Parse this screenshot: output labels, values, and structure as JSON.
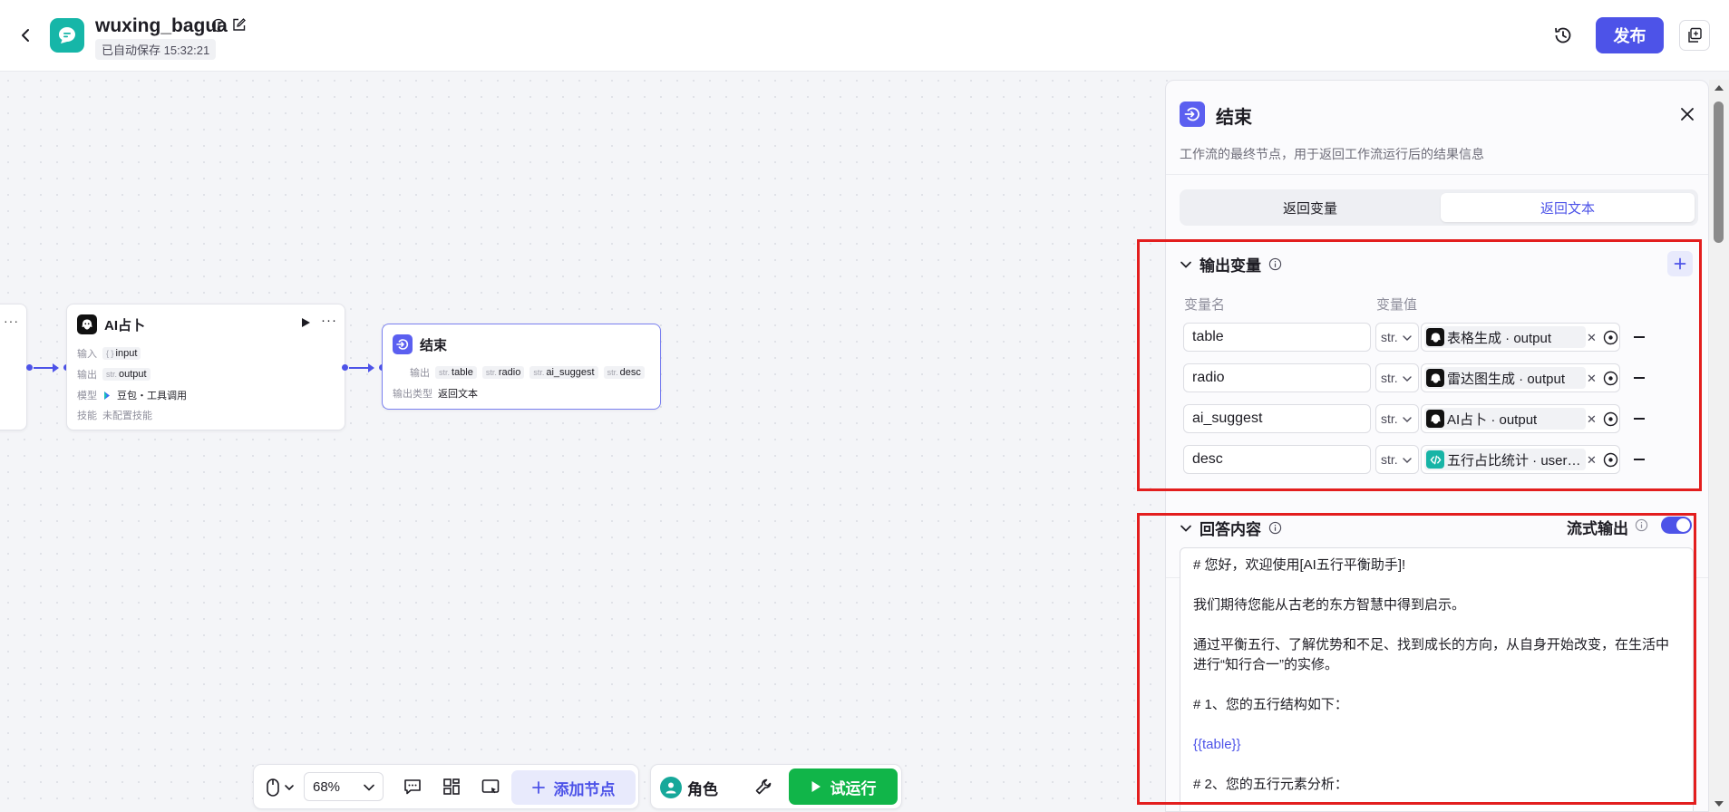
{
  "header": {
    "app_name": "wuxing_bagua",
    "autosave": "已自动保存 15:32:21",
    "publish_label": "发布",
    "colors": {
      "primary": "#4d53e8",
      "logo_bg": "#16b6a8"
    }
  },
  "canvas": {
    "ai_node": {
      "title": "AI占卜",
      "input_label": "输入",
      "input_tag_prefix": "{ }",
      "input_tag": "input",
      "output_label": "输出",
      "output_tag_prefix": "str.",
      "output_tag": "output",
      "model_label": "模型",
      "model_value": "豆包・工具调用",
      "skill_label": "技能",
      "skill_value": "未配置技能"
    },
    "end_node": {
      "title": "结束",
      "output_label": "输出",
      "tag_prefix": "str.",
      "outputs": [
        "table",
        "radio",
        "ai_suggest",
        "desc"
      ],
      "output_type_label": "输出类型",
      "output_type_value": "返回文本"
    }
  },
  "toolbar": {
    "zoom": "68%",
    "add_node_label": "添加节点",
    "role_label": "角色",
    "run_label": "试运行",
    "colors": {
      "run": "#11b549"
    }
  },
  "panel": {
    "title": "结束",
    "description": "工作流的最终节点，用于返回工作流运行后的结果信息",
    "tabs": [
      "返回变量",
      "返回文本"
    ],
    "active_tab": "返回文本",
    "output_section": {
      "title": "输出变量",
      "col_name": "变量名",
      "col_value": "变量值",
      "variables": [
        {
          "name": "table",
          "type": "str.",
          "source": "表格生成 · output",
          "icon": "bot-icon"
        },
        {
          "name": "radio",
          "type": "str.",
          "source": "雷达图生成 · output",
          "icon": "bot-icon"
        },
        {
          "name": "ai_suggest",
          "type": "str.",
          "source": "AI占卜 · output",
          "icon": "bot-icon"
        },
        {
          "name": "desc",
          "type": "str.",
          "source": "五行占比统计 · user_wuxi…",
          "icon": "code-icon"
        }
      ]
    },
    "answer_section": {
      "title": "回答内容",
      "stream_label": "流式输出",
      "stream_enabled": true,
      "lines": [
        "# 您好，欢迎使用[AI五行平衡助手]!",
        "我们期待您能从古老的东方智慧中得到启示。",
        "通过平衡五行、了解优势和不足、找到成长的方向，从自身开始改变，在生活中进行“知行合一”的实修。",
        "# 1、您的五行结构如下：",
        "{{table}}",
        "# 2、您的五行元素分析："
      ]
    }
  }
}
